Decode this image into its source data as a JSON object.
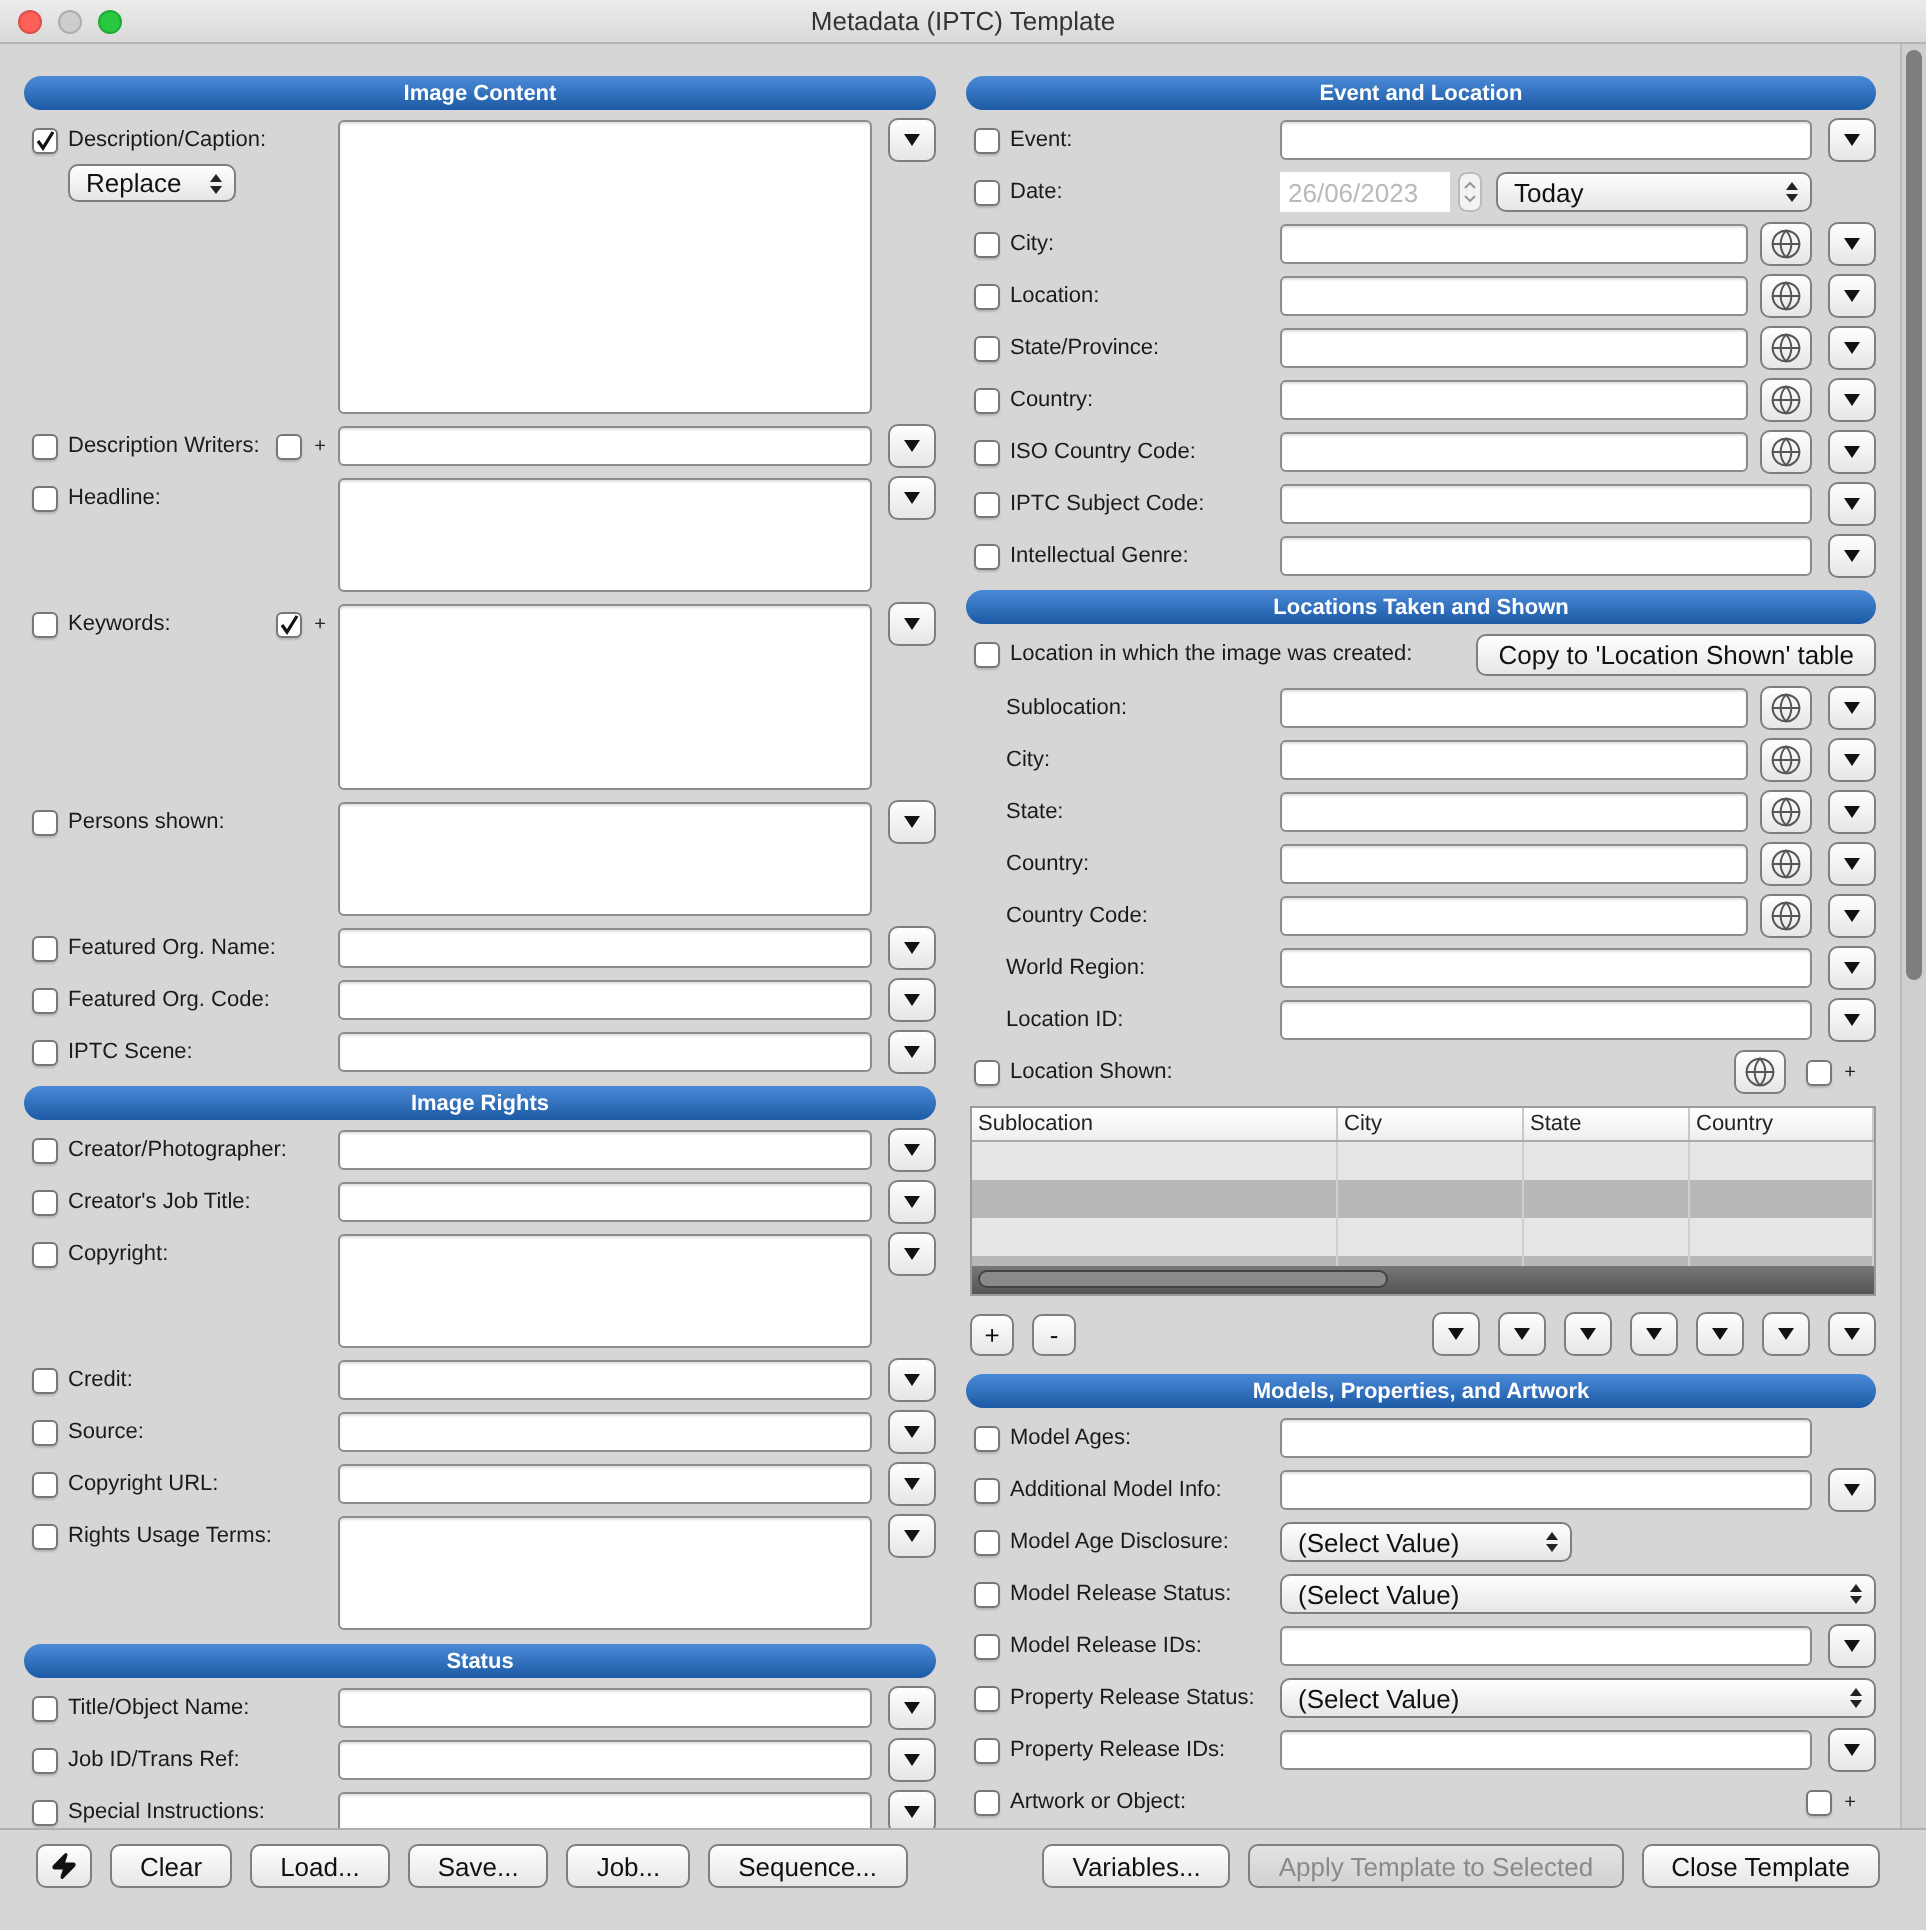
{
  "window": {
    "title": "Metadata (IPTC) Template"
  },
  "columns": [
    {
      "sections": [
        {
          "title": "Image Content",
          "rows": [
            {
              "kind": "area",
              "tall": true,
              "label": "Description/Caption:",
              "checked": true,
              "menu": true,
              "popup": "Replace"
            },
            {
              "kind": "text",
              "label": "Description Writers:",
              "checked": false,
              "menu": true,
              "add": {
                "checked": false,
                "sign": "+"
              }
            },
            {
              "kind": "area",
              "label": "Headline:",
              "checked": false,
              "menu": true
            },
            {
              "kind": "area",
              "large": true,
              "label": "Keywords:",
              "checked": false,
              "menu": true,
              "add": {
                "checked": true,
                "sign": "+"
              }
            },
            {
              "kind": "area",
              "label": "Persons shown:",
              "checked": false,
              "menu": true
            },
            {
              "kind": "text",
              "label": "Featured Org. Name:",
              "checked": false,
              "menu": true
            },
            {
              "kind": "text",
              "label": "Featured Org. Code:",
              "checked": false,
              "menu": true
            },
            {
              "kind": "text",
              "label": "IPTC Scene:",
              "checked": false,
              "menu": true
            }
          ]
        },
        {
          "title": "Image Rights",
          "rows": [
            {
              "kind": "text",
              "label": "Creator/Photographer:",
              "checked": false,
              "menu": true
            },
            {
              "kind": "text",
              "label": "Creator's Job Title:",
              "checked": false,
              "menu": true
            },
            {
              "kind": "area",
              "label": "Copyright:",
              "checked": false,
              "menu": true
            },
            {
              "kind": "text",
              "label": "Credit:",
              "checked": false,
              "menu": true
            },
            {
              "kind": "text",
              "label": "Source:",
              "checked": false,
              "menu": true
            },
            {
              "kind": "text",
              "label": "Copyright URL:",
              "checked": false,
              "menu": true
            },
            {
              "kind": "area",
              "label": "Rights Usage Terms:",
              "checked": false,
              "menu": true
            }
          ]
        },
        {
          "title": "Status",
          "rows": [
            {
              "kind": "text",
              "label": "Title/Object Name:",
              "checked": false,
              "menu": true
            },
            {
              "kind": "text",
              "label": "Job ID/Trans Ref:",
              "checked": false,
              "menu": true
            },
            {
              "kind": "area",
              "label": "Special Instructions:",
              "checked": false,
              "menu": true
            }
          ]
        }
      ]
    },
    {
      "sections": [
        {
          "title": "Event and Location",
          "rows": [
            {
              "kind": "text",
              "label": "Event:",
              "checked": false,
              "menu": true
            },
            {
              "kind": "date",
              "label": "Date:",
              "checked": false,
              "value": "26/06/2023",
              "disabled": true,
              "popup": "Today"
            },
            {
              "kind": "text",
              "label": "City:",
              "checked": false,
              "globe": true,
              "menu": true
            },
            {
              "kind": "text",
              "label": "Location:",
              "checked": false,
              "globe": true,
              "menu": true
            },
            {
              "kind": "text",
              "label": "State/Province:",
              "checked": false,
              "globe": true,
              "menu": true
            },
            {
              "kind": "text",
              "label": "Country:",
              "checked": false,
              "globe": true,
              "menu": true
            },
            {
              "kind": "text",
              "label": "ISO Country Code:",
              "checked": false,
              "globe": true,
              "menu": true
            },
            {
              "kind": "text",
              "label": "IPTC Subject Code:",
              "checked": false,
              "menu": true
            },
            {
              "kind": "text",
              "label": "Intellectual Genre:",
              "checked": false,
              "menu": true
            }
          ]
        },
        {
          "title": "Locations Taken and Shown",
          "rows": [
            {
              "kind": "button",
              "label": "Location in which the image was created:",
              "checked": false,
              "button": "Copy to 'Location Shown' table"
            },
            {
              "kind": "text",
              "label": "Sublocation:",
              "globe": true,
              "menu": true
            },
            {
              "kind": "text",
              "label": "City:",
              "globe": true,
              "menu": true
            },
            {
              "kind": "text",
              "label": "State:",
              "globe": true,
              "menu": true
            },
            {
              "kind": "text",
              "label": "Country:",
              "globe": true,
              "menu": true
            },
            {
              "kind": "text",
              "label": "Country Code:",
              "globe": true,
              "menu": true
            },
            {
              "kind": "text",
              "label": "World Region:",
              "menu": true
            },
            {
              "kind": "text",
              "label": "Location ID:",
              "menu": true
            },
            {
              "kind": "label",
              "label": "Location Shown:",
              "checked": false,
              "globe": true,
              "add": {
                "checked": false,
                "sign": "+"
              }
            },
            {
              "kind": "table",
              "columns": [
                "Sublocation",
                "City",
                "State",
                "Country"
              ]
            },
            {
              "kind": "table-controls",
              "buttons": [
                "+",
                "-"
              ],
              "menus": [
                {
                  "kind": "menu"
                },
                {
                  "kind": "menu"
                },
                {
                  "kind": "menu"
                },
                {
                  "kind": "menu"
                },
                {
                  "kind": "menu"
                },
                {
                  "kind": "menu"
                },
                {
                  "kind": "menu"
                }
              ]
            }
          ]
        },
        {
          "title": "Models, Properties, and Artwork",
          "rows": [
            {
              "kind": "text",
              "label": "Model Ages:",
              "checked": false,
              "menu": false
            },
            {
              "kind": "text",
              "label": "Additional Model Info:",
              "checked": false,
              "menu": true
            },
            {
              "kind": "popup",
              "label": "Model Age Disclosure:",
              "checked": false,
              "value": "(Select Value)",
              "short": true
            },
            {
              "kind": "popup",
              "label": "Model Release Status:",
              "checked": false,
              "value": "(Select Value)"
            },
            {
              "kind": "text",
              "label": "Model Release IDs:",
              "checked": false,
              "menu": true
            },
            {
              "kind": "popup",
              "label": "Property Release Status:",
              "checked": false,
              "value": "(Select Value)"
            },
            {
              "kind": "text",
              "label": "Property Release IDs:",
              "checked": false,
              "menu": true
            },
            {
              "kind": "label",
              "label": "Artwork or Object:",
              "checked": false,
              "add": {
                "checked": false,
                "sign": "+"
              }
            }
          ]
        }
      ]
    }
  ],
  "bottom_bar": {
    "left": [
      {
        "kind": "icon",
        "disabled": false
      },
      {
        "kind": "text",
        "label": "Clear",
        "disabled": false
      },
      {
        "kind": "text",
        "label": "Load...",
        "disabled": false
      },
      {
        "kind": "text",
        "label": "Save...",
        "disabled": false
      },
      {
        "kind": "text",
        "label": "Job...",
        "disabled": false
      },
      {
        "kind": "text",
        "label": "Sequence...",
        "disabled": false
      }
    ],
    "right": [
      {
        "kind": "text",
        "label": "Variables...",
        "disabled": false
      },
      {
        "kind": "text",
        "label": "Apply Template to Selected",
        "disabled": true
      },
      {
        "kind": "text",
        "label": "Close Template",
        "disabled": false
      }
    ]
  }
}
